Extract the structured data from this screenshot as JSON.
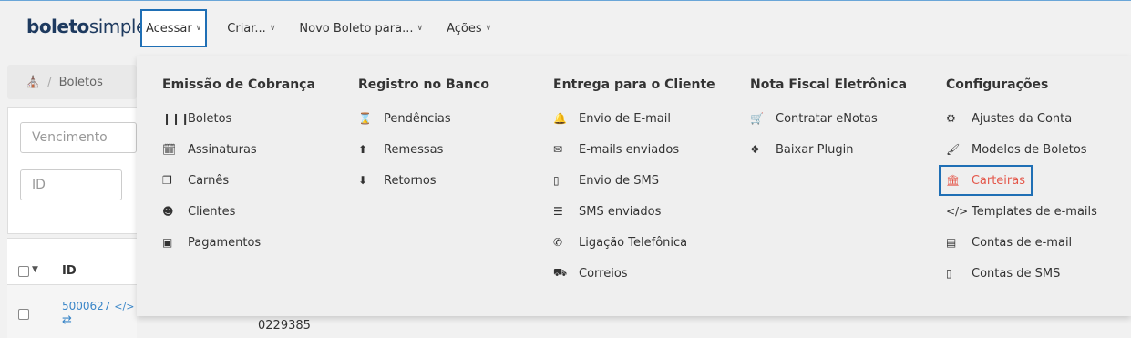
{
  "app": {
    "logo_bold": "boleto",
    "logo_light": "simples"
  },
  "nav": {
    "items": [
      {
        "label": "Acessar"
      },
      {
        "label": "Criar..."
      },
      {
        "label": "Novo Boleto para..."
      },
      {
        "label": "Ações"
      }
    ]
  },
  "page": {
    "breadcrumb_current": "Boletos",
    "breadcrumb_sep": "/",
    "filter_vencimento_placeholder": "Vencimento",
    "filter_id_placeholder": "ID",
    "table_header_id": "ID",
    "row_id": "5000627",
    "row_code_icon": "</>",
    "row_arrows": "⇄",
    "row_number_partial": "0229385"
  },
  "menu": {
    "columns": [
      {
        "title": "Emissão de Cobrança",
        "items": [
          {
            "label": "Boletos",
            "icon": "barcode-icon"
          },
          {
            "label": "Assinaturas",
            "icon": "calendar-check-icon"
          },
          {
            "label": "Carnês",
            "icon": "copy-icon"
          },
          {
            "label": "Clientes",
            "icon": "users-icon"
          },
          {
            "label": "Pagamentos",
            "icon": "money-icon"
          }
        ]
      },
      {
        "title": "Registro no Banco",
        "items": [
          {
            "label": "Pendências",
            "icon": "hourglass-icon"
          },
          {
            "label": "Remessas",
            "icon": "upload-icon"
          },
          {
            "label": "Retornos",
            "icon": "download-icon"
          }
        ]
      },
      {
        "title": "Entrega para o Cliente",
        "items": [
          {
            "label": "Envio de E-mail",
            "icon": "bell-icon"
          },
          {
            "label": "E-mails enviados",
            "icon": "envelope-icon"
          },
          {
            "label": "Envio de SMS",
            "icon": "mobile-icon"
          },
          {
            "label": "SMS enviados",
            "icon": "list-icon"
          },
          {
            "label": "Ligação Telefônica",
            "icon": "phone-icon"
          },
          {
            "label": "Correios",
            "icon": "truck-icon"
          }
        ]
      },
      {
        "title": "Nota Fiscal Eletrônica",
        "items": [
          {
            "label": "Contratar eNotas",
            "icon": "cart-icon"
          },
          {
            "label": "Baixar Plugin",
            "icon": "puzzle-icon"
          }
        ]
      },
      {
        "title": "Configurações",
        "items": [
          {
            "label": "Ajustes da Conta",
            "icon": "cogs-icon"
          },
          {
            "label": "Modelos de Boletos",
            "icon": "brush-icon"
          },
          {
            "label": "Carteiras",
            "icon": "bank-icon",
            "highlighted": true
          },
          {
            "label": "Templates de e-mails",
            "icon": "code-icon"
          },
          {
            "label": "Contas de e-mail",
            "icon": "server-icon"
          },
          {
            "label": "Contas de SMS",
            "icon": "mobile-icon"
          }
        ]
      }
    ]
  },
  "colors": {
    "accent_blue": "#1f6fb5",
    "highlight_red": "#e4574a",
    "link_blue": "#3a86c8"
  }
}
